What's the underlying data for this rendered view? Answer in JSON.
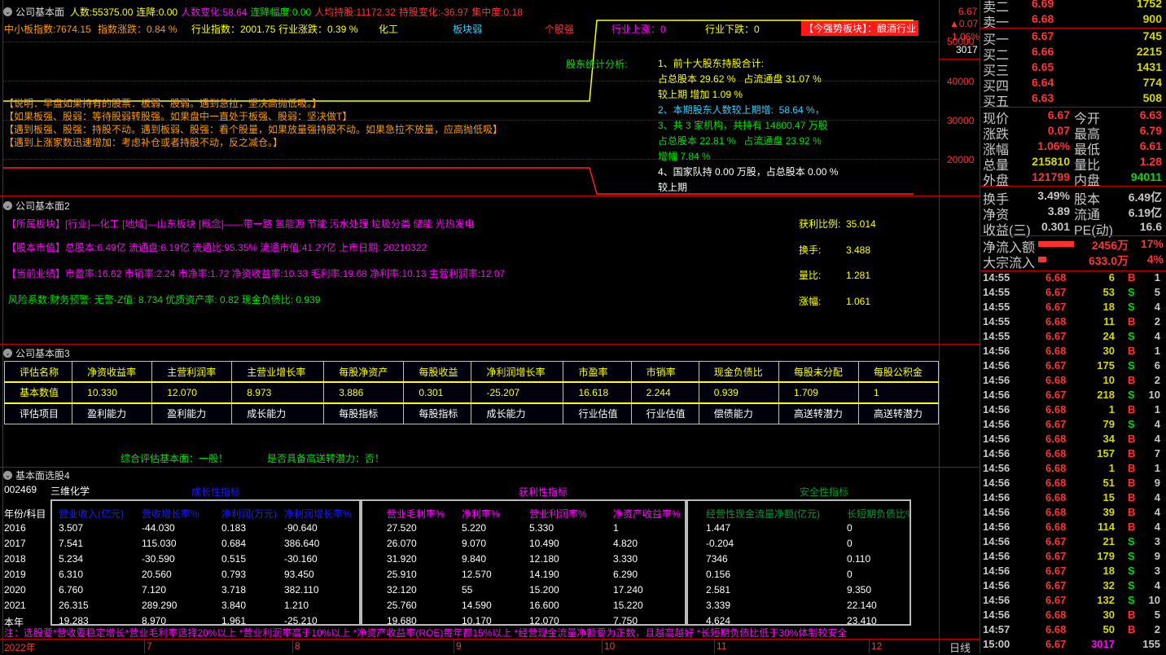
{
  "panel1": {
    "title": "公司基本面",
    "stats": [
      {
        "label": "人数:",
        "value": "55375.00",
        "color": "y"
      },
      {
        "label": "连降:",
        "value": "0.00",
        "color": "y"
      },
      {
        "label": "人数变化:",
        "value": "58.64",
        "color": "m"
      },
      {
        "label": "连降幅度:",
        "value": "0.00",
        "color": "g"
      },
      {
        "label": "人均持股:",
        "value": "11172.32",
        "color": "r"
      },
      {
        "label": "持股变化:",
        "value": "-36.97",
        "color": "r"
      },
      {
        "label": "集中度:",
        "value": "0.18",
        "color": "r"
      }
    ],
    "index_line": {
      "sme_index": "中小板指数:7674.15",
      "index_change": "指数涨跌：0.84 %",
      "industry_index": "行业指数：2001.75",
      "industry_change": "行业涨跌：0.39 %",
      "industry": "化工",
      "sector_state": "板块弱",
      "stock_state": "个股强",
      "industry_up": "行业上涨：0",
      "industry_down": "行业下跌：0",
      "strong_sector": "【今强势板块】：酿酒行业"
    },
    "notes": [
      "【说明：早盘如果持有的股票：板弱、股弱。遇到急拉，坚决高抛低吸。】",
      "【如果板强、股弱：等待股弱转股强。如果盘中一直处于板强、股弱：坚决做T】",
      "【遇到板强、股强：持股不动。遇到板弱、股强：看个股量，如果放量强持股不动。如果急拉不放量，应高抛低吸】",
      "【遇到上涨家数迅速增加：考虑补仓或者持股不动，反之减仓。】"
    ],
    "holder_label": "股东统计分析:",
    "holder": [
      {
        "t": "1、前十大股东持股合计:",
        "c": "y"
      },
      {
        "t": "占总股本 29.62 %   占流通盘 31.07 %",
        "c": "y"
      },
      {
        "t": "较上期 增加 1.09 %",
        "c": "y"
      },
      {
        "t": "2、本期股东人数较上期增:  58.64 %，",
        "c": "c"
      },
      {
        "t": "3、共 3 家机构，共持有 14800.47 万股",
        "c": "g"
      },
      {
        "t": "占总股本 22.81 %   占流通盘 23.92 %",
        "c": "g"
      },
      {
        "t": "增幅 7.84 %",
        "c": "g"
      },
      {
        "t": "4、国家队持 0.00 万股，占总股本 0.00 %",
        "c": "w"
      },
      {
        "t": "较上期",
        "c": "w"
      }
    ]
  },
  "axis": {
    "price": "6.67",
    "change": "▲0.07",
    "pct": "1.06%",
    "vol_top": "50000",
    "last_vol": "3017",
    "ticks": [
      "40000",
      "30000",
      "20000"
    ]
  },
  "panel2": {
    "title": "公司基本面2",
    "sector": "【所属板块】[行业]—化工 [地域]—山东板块 [概念]——带一路 氢能源 节能 污水处理 垃圾分类 储能 光热发电",
    "equity": "【股本市值】总股本:6.49亿 流通盘:6.19亿 流通比:95.35% 流通市值:41.27亿 上市日期: 20210322",
    "perf": "【当前业绩】市盈率:16.62 市销率:2.24 市净率:1.72 净资收益率:10.33 毛利率:19.68 净利率:10.13 主营利润率:12.07",
    "risk": "风险系数:财务预警: 无警-Z值: 8.734 优质资产率: 0.82 现金负债比: 0.939",
    "side": [
      {
        "l": "获利比例:",
        "v": "35.014"
      },
      {
        "l": "换手:",
        "v": "3.488"
      },
      {
        "l": "量比:",
        "v": "1.281"
      },
      {
        "l": "涨幅:",
        "v": "1.061"
      }
    ]
  },
  "panel3": {
    "title": "公司基本面3",
    "headers": [
      "评估名称",
      "净资收益率",
      "主营利润率",
      "主营业增长率",
      "每股净资产",
      "每股收益",
      "净利润增长率",
      "市盈率",
      "市销率",
      "现金负债比",
      "每股未分配",
      "每股公积金"
    ],
    "values": [
      "基本数值",
      "10.330",
      "12.070",
      "8.973",
      "3.886",
      "0.301",
      "-25.207",
      "16.618",
      "2.244",
      "0.939",
      "1.709",
      "1"
    ],
    "items": [
      "评估项目",
      "盈利能力",
      "盈利能力",
      "成长能力",
      "每股指标",
      "每股指标",
      "成长能力",
      "行业估值",
      "行业估值",
      "偿债能力",
      "高送转潜力",
      "高送转潜力"
    ],
    "summary1": "综合评估基本面：一般！",
    "summary2": "是否具备高送转潜力：否！"
  },
  "panel4": {
    "title": "基本面选股4",
    "code": "002469",
    "name": "三维化学",
    "row_header": "年份/科目",
    "years": [
      "2016",
      "2017",
      "2018",
      "2019",
      "2020",
      "2021",
      "本年"
    ],
    "groups": [
      {
        "title": "成长性指标",
        "color": "bl",
        "cols": [
          "营业收入(亿元)",
          "营收增长率%",
          "净利润(万元)",
          "净利润增长率%"
        ],
        "rows": [
          [
            "3.507",
            "-44.030",
            "0.183",
            "-90.640"
          ],
          [
            "7.541",
            "115.030",
            "0.684",
            "386.640"
          ],
          [
            "5.234",
            "-30.590",
            "0.515",
            "-30.160"
          ],
          [
            "6.310",
            "20.560",
            "0.793",
            "93.450"
          ],
          [
            "6.760",
            "7.120",
            "3.718",
            "382.110"
          ],
          [
            "26.315",
            "289.290",
            "3.840",
            "1.210"
          ],
          [
            "19.283",
            "8.970",
            "1.961",
            "-25.210"
          ]
        ]
      },
      {
        "title": "获利性指标",
        "color": "m",
        "cols": [
          "营业毛利率%",
          "净利率%",
          "营业利润率%",
          "净资产收益率%"
        ],
        "rows": [
          [
            "27.520",
            "5.220",
            "5.330",
            "1"
          ],
          [
            "26.070",
            "9.070",
            "10.490",
            "4.820"
          ],
          [
            "31.920",
            "9.840",
            "12.180",
            "3.330"
          ],
          [
            "25.910",
            "12.570",
            "14.190",
            "6.290"
          ],
          [
            "32.120",
            "55",
            "15.200",
            "17.240"
          ],
          [
            "25.760",
            "14.590",
            "16.600",
            "15.220"
          ],
          [
            "19.680",
            "10.170",
            "12.070",
            "7.750"
          ]
        ]
      },
      {
        "title": "安全性指标",
        "color": "dg",
        "cols": [
          "经营性现金流量净额(亿元)",
          "长短期负债比%"
        ],
        "rows": [
          [
            "1.447",
            "0"
          ],
          [
            "-0.204",
            "0"
          ],
          [
            "7346",
            "0.110"
          ],
          [
            "0.156",
            "0"
          ],
          [
            "2.581",
            "9.350"
          ],
          [
            "3.339",
            "22.140"
          ],
          [
            "4.624",
            "23.410"
          ]
        ]
      }
    ],
    "note": "注：选股要*营收要稳定增长*营业毛利率选择20%以上 *营业利润率高于10%以上 *净资产收益率(ROE)每年都15%以上 *经营现金流量净额要为正数，且越高越好 *长短期负债比低于30%体制较安全"
  },
  "timeline": {
    "labels": [
      "2022年",
      "7",
      "8",
      "9",
      "10",
      "11",
      "12"
    ],
    "period": "日线"
  },
  "orderbook": {
    "asks": [
      {
        "l": "卖二",
        "p": "6.69",
        "v": "1752"
      },
      {
        "l": "卖一",
        "p": "6.68",
        "v": "900"
      }
    ],
    "bids": [
      {
        "l": "买一",
        "p": "6.67",
        "v": "745"
      },
      {
        "l": "买二",
        "p": "6.66",
        "v": "2215"
      },
      {
        "l": "买三",
        "p": "6.65",
        "v": "1431"
      },
      {
        "l": "买四",
        "p": "6.64",
        "v": "774"
      },
      {
        "l": "买五",
        "p": "6.63",
        "v": "508"
      }
    ]
  },
  "quote": [
    {
      "l1": "现价",
      "v1": "6.67",
      "c1": "r",
      "l2": "今开",
      "v2": "6.63",
      "c2": "r"
    },
    {
      "l1": "涨跌",
      "v1": "0.07",
      "c1": "r",
      "l2": "最高",
      "v2": "6.79",
      "c2": "r"
    },
    {
      "l1": "涨幅",
      "v1": "1.06%",
      "c1": "r",
      "l2": "最低",
      "v2": "6.61",
      "c2": "r"
    },
    {
      "l1": "总量",
      "v1": "215810",
      "c1": "yl",
      "l2": "量比",
      "v2": "1.28",
      "c2": "r"
    },
    {
      "l1": "外盘",
      "v1": "121799",
      "c1": "r",
      "l2": "内盘",
      "v2": "94011",
      "c2": "g"
    },
    {
      "l1": "换手",
      "v1": "3.49%",
      "c1": "gr",
      "l2": "股本",
      "v2": "6.49亿",
      "c2": "gr"
    },
    {
      "l1": "净资",
      "v1": "3.89",
      "c1": "gr",
      "l2": "流通",
      "v2": "6.19亿",
      "c2": "gr"
    },
    {
      "l1": "收益(三)",
      "v1": "0.301",
      "c1": "gr",
      "l2": "PE(动)",
      "v2": "16.6",
      "c2": "gr"
    }
  ],
  "flows": [
    {
      "l": "净流入额",
      "v": "2456万",
      "p": "17%",
      "bar": 0.17
    },
    {
      "l": "大宗流入",
      "v": "633.0万",
      "p": "4%",
      "bar": 0.04
    }
  ],
  "trades": [
    [
      "14:55",
      "6.68",
      "6",
      "B",
      "1"
    ],
    [
      "14:55",
      "6.67",
      "53",
      "S",
      "5"
    ],
    [
      "14:55",
      "6.67",
      "18",
      "S",
      "4"
    ],
    [
      "14:55",
      "6.68",
      "11",
      "B",
      "2"
    ],
    [
      "14:55",
      "6.67",
      "24",
      "S",
      "4"
    ],
    [
      "14:56",
      "6.68",
      "30",
      "B",
      "1"
    ],
    [
      "14:56",
      "6.67",
      "175",
      "S",
      "6"
    ],
    [
      "14:56",
      "6.68",
      "10",
      "B",
      "2"
    ],
    [
      "14:56",
      "6.67",
      "218",
      "S",
      "10"
    ],
    [
      "14:56",
      "6.68",
      "1",
      "B",
      "1"
    ],
    [
      "14:56",
      "6.67",
      "79",
      "S",
      "4"
    ],
    [
      "14:56",
      "6.68",
      "34",
      "B",
      "4"
    ],
    [
      "14:56",
      "6.68",
      "157",
      "B",
      "7"
    ],
    [
      "14:56",
      "6.68",
      "1",
      "B",
      "1"
    ],
    [
      "14:56",
      "6.68",
      "51",
      "B",
      "9"
    ],
    [
      "14:56",
      "6.68",
      "15",
      "B",
      "4"
    ],
    [
      "14:56",
      "6.68",
      "39",
      "B",
      "4"
    ],
    [
      "14:56",
      "6.68",
      "114",
      "B",
      "4"
    ],
    [
      "14:56",
      "6.67",
      "21",
      "S",
      "3"
    ],
    [
      "14:56",
      "6.67",
      "179",
      "S",
      "9"
    ],
    [
      "14:56",
      "6.67",
      "18",
      "S",
      "3"
    ],
    [
      "14:56",
      "6.67",
      "32",
      "S",
      "4"
    ],
    [
      "14:56",
      "6.67",
      "132",
      "S",
      "10"
    ],
    [
      "14:56",
      "6.68",
      "30",
      "B",
      "5"
    ],
    [
      "14:57",
      "6.68",
      "50",
      "B",
      "2"
    ],
    [
      "15:00",
      "6.67",
      "3017",
      "",
      "155"
    ]
  ]
}
